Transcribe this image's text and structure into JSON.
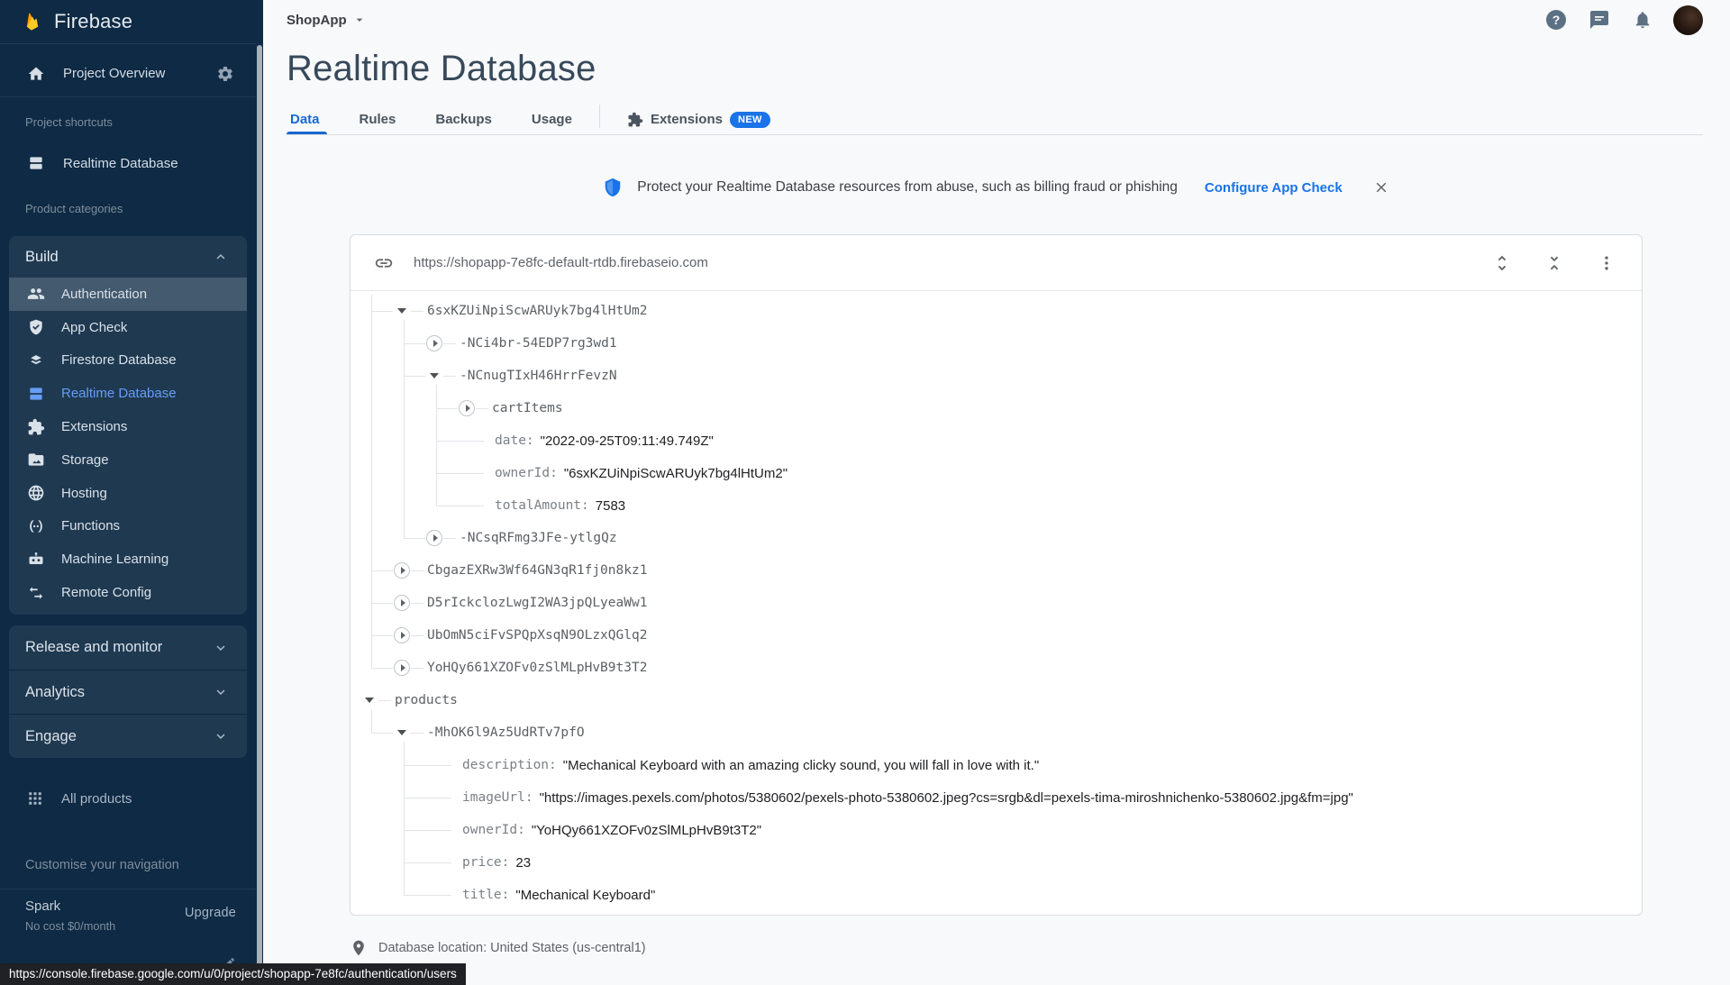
{
  "sidebar": {
    "brand": "Firebase",
    "project_overview": "Project Overview",
    "shortcuts_label": "Project shortcuts",
    "shortcut_realtime_db": "Realtime Database",
    "categories_label": "Product categories",
    "build": {
      "label": "Build",
      "items": [
        {
          "label": "Authentication",
          "icon": "people-icon",
          "highlighted": true
        },
        {
          "label": "App Check",
          "icon": "shield-check-icon"
        },
        {
          "label": "Firestore Database",
          "icon": "firestore-icon"
        },
        {
          "label": "Realtime Database",
          "icon": "database-icon",
          "selected": true
        },
        {
          "label": "Extensions",
          "icon": "puzzle-icon"
        },
        {
          "label": "Storage",
          "icon": "folder-icon"
        },
        {
          "label": "Hosting",
          "icon": "globe-icon"
        },
        {
          "label": "Functions",
          "icon": "functions-icon"
        },
        {
          "label": "Machine Learning",
          "icon": "robot-icon"
        },
        {
          "label": "Remote Config",
          "icon": "remote-config-icon"
        }
      ]
    },
    "sections": [
      {
        "label": "Release and monitor"
      },
      {
        "label": "Analytics"
      },
      {
        "label": "Engage"
      }
    ],
    "all_products": "All products",
    "customise_label": "Customise your navigation",
    "plan": {
      "name": "Spark",
      "cost": "No cost $0/month",
      "upgrade_label": "Upgrade"
    }
  },
  "topbar": {
    "project_switcher": "ShopApp"
  },
  "page": {
    "title": "Realtime Database",
    "tabs": [
      {
        "label": "Data",
        "active": true
      },
      {
        "label": "Rules"
      },
      {
        "label": "Backups"
      },
      {
        "label": "Usage"
      },
      {
        "label": "Extensions",
        "icon": "puzzle-icon",
        "badge": "NEW",
        "divider_before": true
      }
    ]
  },
  "banner": {
    "text": "Protect your Realtime Database resources from abuse, such as billing fraud or phishing",
    "action_label": "Configure App Check"
  },
  "database_panel": {
    "url": "https://shopapp-7e8fc-default-rtdb.firebaseio.com",
    "tree": {
      "rows": [
        {
          "depth": 2,
          "toggle": "expanded",
          "key": "6sxKZUiNpiScwARUyk7bg4lHtUm2"
        },
        {
          "depth": 3,
          "toggle": "collapsed",
          "key": "-NCi4br-54EDP7rg3wd1"
        },
        {
          "depth": 3,
          "toggle": "expanded",
          "key": "-NCnugTIxH46HrrFevzN"
        },
        {
          "depth": 4,
          "toggle": "collapsed",
          "key": "cartItems"
        },
        {
          "depth": 4,
          "key": "date",
          "value": "2022-09-25T09:11:49.749Z",
          "quoted": true
        },
        {
          "depth": 4,
          "key": "ownerId",
          "value": "6sxKZUiNpiScwARUyk7bg4lHtUm2",
          "quoted": true
        },
        {
          "depth": 4,
          "key": "totalAmount",
          "value": "7583",
          "quoted": false
        },
        {
          "depth": 3,
          "toggle": "collapsed",
          "key": "-NCsqRFmg3JFe-ytlgQz"
        },
        {
          "depth": 2,
          "toggle": "collapsed",
          "key": "CbgazEXRw3Wf64GN3qR1fj0n8kz1"
        },
        {
          "depth": 2,
          "toggle": "collapsed",
          "key": "D5rIckclozLwgI2WA3jpQLyeaWw1"
        },
        {
          "depth": 2,
          "toggle": "collapsed",
          "key": "UbOmN5ciFvSPQpXsqN9OLzxQGlq2"
        },
        {
          "depth": 2,
          "toggle": "collapsed",
          "key": "YoHQy661XZOFv0zSlMLpHvB9t3T2"
        },
        {
          "depth": 1,
          "toggle": "expanded",
          "key": "products"
        },
        {
          "depth": 2,
          "toggle": "expanded",
          "key": "-MhOK6l9Az5UdRTv7pfO"
        },
        {
          "depth": 3,
          "key": "description",
          "value": "Mechanical Keyboard with an amazing clicky sound, you will fall in love with it.",
          "quoted": true
        },
        {
          "depth": 3,
          "key": "imageUrl",
          "value": "https://images.pexels.com/photos/5380602/pexels-photo-5380602.jpeg?cs=srgb&dl=pexels-tima-miroshnichenko-5380602.jpg&fm=jpg",
          "quoted": true
        },
        {
          "depth": 3,
          "key": "ownerId",
          "value": "YoHQy661XZOFv0zSlMLpHvB9t3T2",
          "quoted": true
        },
        {
          "depth": 3,
          "key": "price",
          "value": "23",
          "quoted": false
        },
        {
          "depth": 3,
          "key": "title",
          "value": "Mechanical Keyboard",
          "quoted": true
        }
      ]
    }
  },
  "footer": {
    "location": "Database location: United States (us-central1)"
  },
  "browser": {
    "status_url": "https://console.firebase.google.com/u/0/project/shopapp-7e8fc/authentication/users"
  },
  "colors": {
    "accent": "#1a73e8",
    "sidebar_bg": "#0e2a44",
    "selected_item": "#669df6"
  }
}
